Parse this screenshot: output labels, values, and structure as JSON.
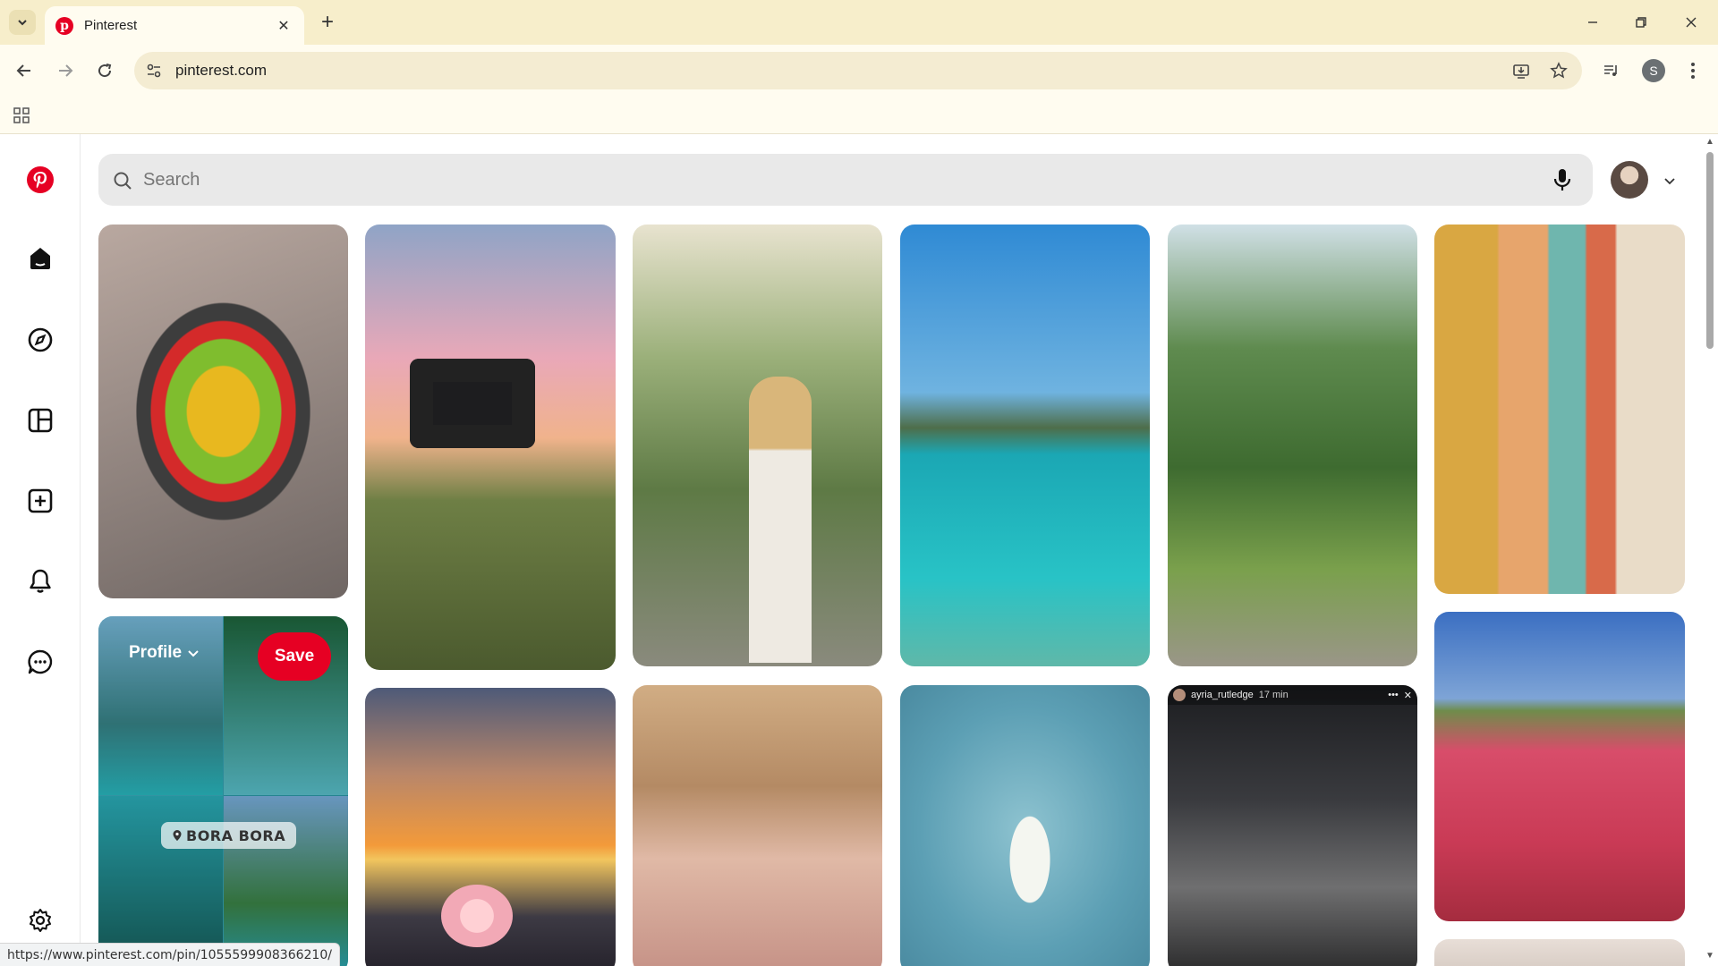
{
  "browser": {
    "tab_title": "Pinterest",
    "url": "pinterest.com",
    "status_url": "https://www.pinterest.com/pin/1055599908366210/",
    "profile_initial": "S"
  },
  "search": {
    "placeholder": "Search",
    "value": ""
  },
  "pins": {
    "hovered": {
      "board_label": "Profile",
      "save_label": "Save",
      "location": "BORA BORA"
    },
    "gym_overlay": {
      "username": "ayria_rutledge",
      "time": "17 min"
    }
  },
  "colors": {
    "brand": "#e60023",
    "tab_strip": "#f7eecb",
    "toolbar": "#fffcf0"
  },
  "icons": [
    "pinterest-logo-icon",
    "home-icon",
    "explore-icon",
    "dashboard-icon",
    "create-icon",
    "notifications-icon",
    "messages-icon",
    "settings-icon",
    "search-icon",
    "microphone-icon"
  ]
}
